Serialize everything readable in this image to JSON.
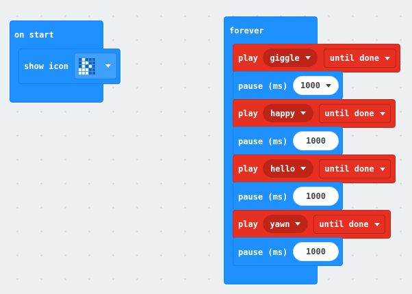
{
  "on_start": {
    "label": "on start",
    "show_icon_label": "show icon"
  },
  "forever": {
    "label": "forever",
    "play_label": "play",
    "until_done_label": "until done",
    "pause_label": "pause (ms)",
    "sounds": [
      "giggle",
      "happy",
      "hello",
      "yawn"
    ],
    "pause_values": [
      "1000",
      "1000",
      "1000",
      "1000"
    ]
  },
  "colors": {
    "canvas": "#ecf0f2",
    "basic_blue": "#1e90ff",
    "music_red": "#e63022"
  },
  "icons": [
    "chevron-down-icon",
    "led-icon-pattern"
  ]
}
